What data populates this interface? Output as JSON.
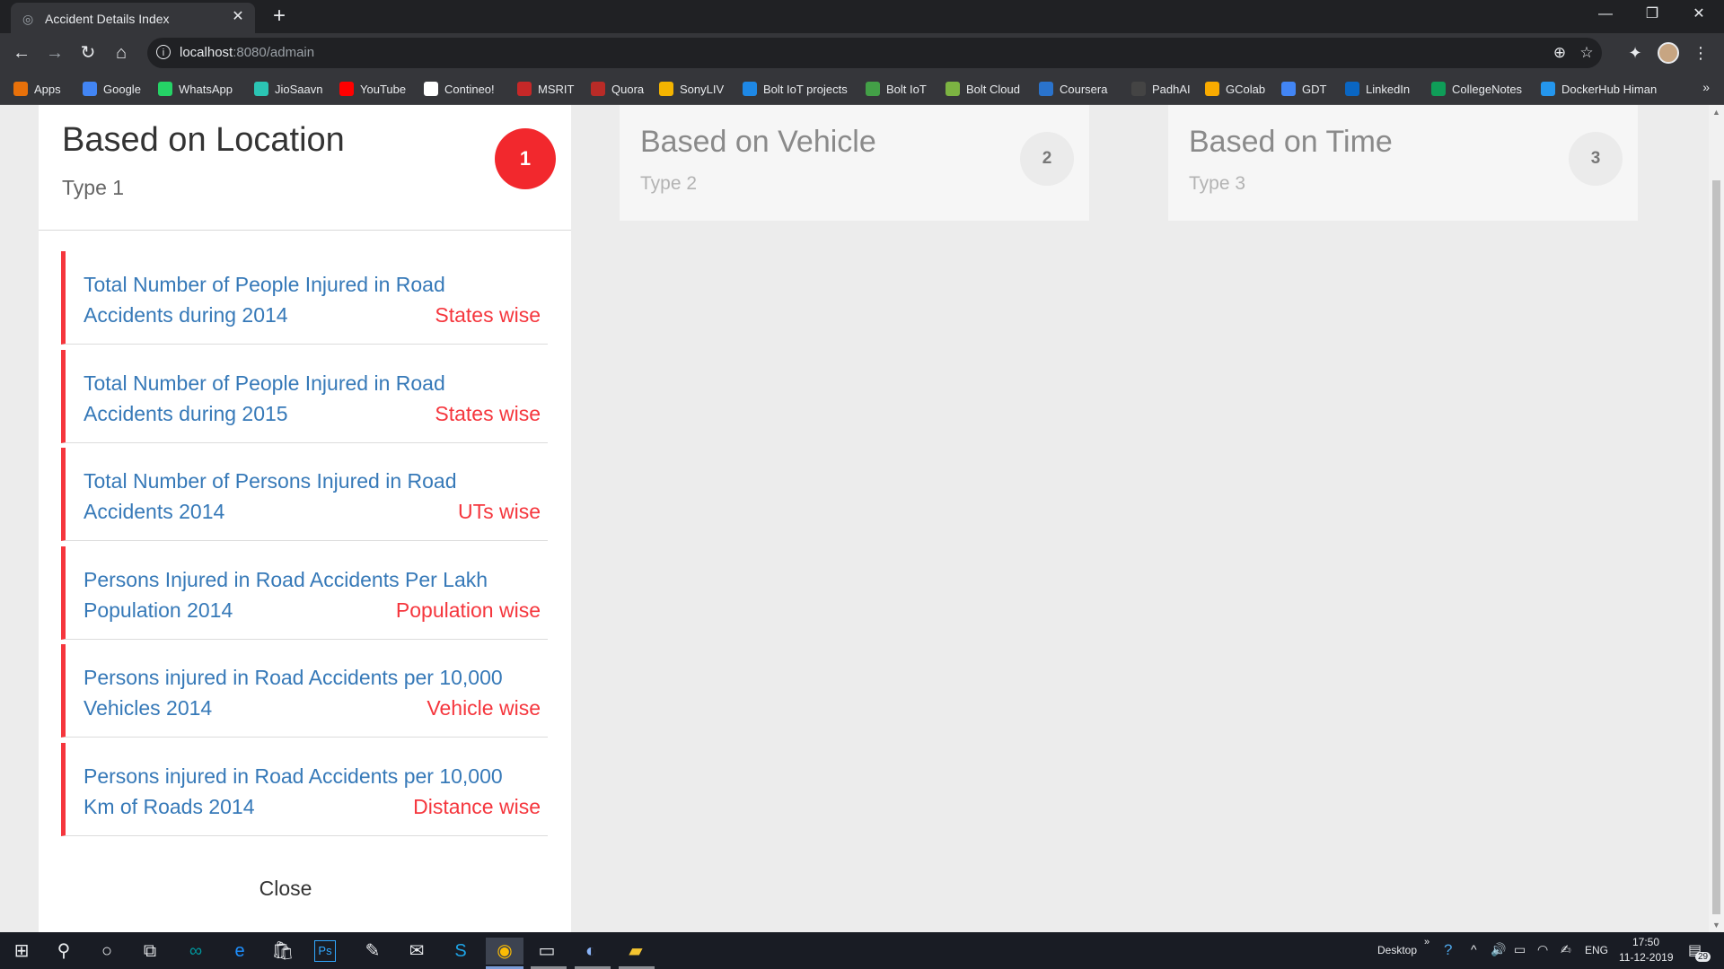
{
  "browser": {
    "tab_title": "Accident Details Index",
    "url_host": "localhost",
    "url_path": ":8080/admain",
    "new_tab_symbol": "+",
    "tab_close_symbol": "✕"
  },
  "bookmarks": [
    {
      "label": "Apps",
      "icon": "apps-grid-icon",
      "color": "#e8710a"
    },
    {
      "label": "Google",
      "icon": "google-icon",
      "color": "#4285f4"
    },
    {
      "label": "WhatsApp",
      "icon": "whatsapp-icon",
      "color": "#25d366"
    },
    {
      "label": "JioSaavn",
      "icon": "jiosaavn-icon",
      "color": "#2bc5b4"
    },
    {
      "label": "YouTube",
      "icon": "youtube-icon",
      "color": "#ff0000"
    },
    {
      "label": "Contineo!",
      "icon": "contineo-icon",
      "color": "#ffffff"
    },
    {
      "label": "MSRIT",
      "icon": "msrit-icon",
      "color": "#c62828"
    },
    {
      "label": "Quora",
      "icon": "quora-icon",
      "color": "#b92b27"
    },
    {
      "label": "SonyLIV",
      "icon": "sonyliv-icon",
      "color": "#f4b400"
    },
    {
      "label": "Bolt IoT projects",
      "icon": "bolt-iot-icon",
      "color": "#1e88e5"
    },
    {
      "label": "Bolt IoT",
      "icon": "bolt-wave-icon",
      "color": "#43a047"
    },
    {
      "label": "Bolt Cloud",
      "icon": "bolt-cloud-icon",
      "color": "#7cb342"
    },
    {
      "label": "Coursera",
      "icon": "coursera-icon",
      "color": "#2a73cc"
    },
    {
      "label": "PadhAI",
      "icon": "padhai-icon",
      "color": "#444444"
    },
    {
      "label": "GColab",
      "icon": "colab-icon",
      "color": "#f9ab00"
    },
    {
      "label": "GDT",
      "icon": "gdt-icon",
      "color": "#4285f4"
    },
    {
      "label": "LinkedIn",
      "icon": "linkedin-icon",
      "color": "#0a66c2"
    },
    {
      "label": "CollegeNotes",
      "icon": "drive-icon",
      "color": "#0f9d58"
    },
    {
      "label": "DockerHub Himan",
      "icon": "docker-icon",
      "color": "#2496ed"
    }
  ],
  "cards": [
    {
      "title": "Based on Location",
      "subtitle": "Type 1",
      "badge": "1",
      "items": [
        {
          "title": "Total Number of People Injured in Road Accidents during 2014",
          "tag": "States wise"
        },
        {
          "title": "Total Number of People Injured in Road Accidents during 2015",
          "tag": "States wise"
        },
        {
          "title": "Total Number of Persons Injured in Road Accidents 2014",
          "tag": "UTs wise"
        },
        {
          "title": "Persons Injured in Road Accidents Per Lakh Population 2014",
          "tag": "Population wise"
        },
        {
          "title": "Persons injured in Road Accidents per 10,000 Vehicles 2014",
          "tag": "Vehicle wise"
        },
        {
          "title": "Persons injured in Road Accidents per 10,000 Km of Roads 2014",
          "tag": "Distance wise"
        }
      ],
      "close_label": "Close"
    },
    {
      "title": "Based on Vehicle",
      "subtitle": "Type 2",
      "badge": "2"
    },
    {
      "title": "Based on Time",
      "subtitle": "Type 3",
      "badge": "3"
    }
  ],
  "colors": {
    "accent_red": "#f5363d",
    "link_blue": "#3679b8",
    "page_bg": "#ececec"
  },
  "taskbar": {
    "desktop_label": "Desktop",
    "language": "ENG",
    "time": "17:50",
    "date": "11-12-2019",
    "notification_count": "29",
    "overflow_symbol": "»"
  }
}
